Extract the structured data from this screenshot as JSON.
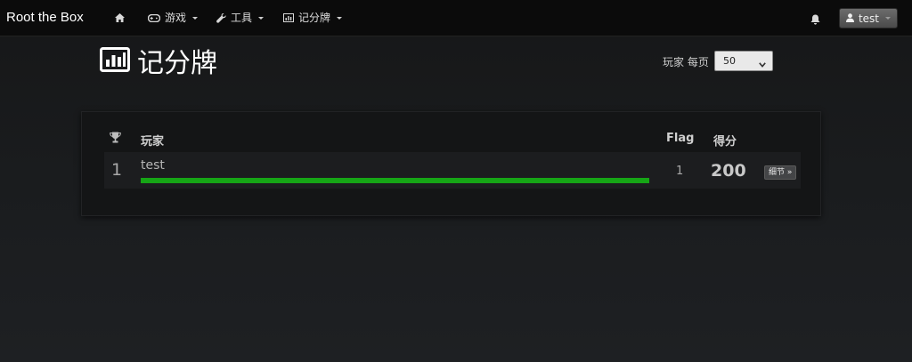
{
  "navbar": {
    "brand": "Root the Box",
    "items": [
      {
        "icon": "home-icon",
        "label": ""
      },
      {
        "icon": "gamepad-icon",
        "label": "游戏"
      },
      {
        "icon": "wrench-icon",
        "label": "工具"
      },
      {
        "icon": "bar-chart-icon",
        "label": "记分牌"
      }
    ],
    "notifications_icon": "bell-icon",
    "user": {
      "icon": "user-icon",
      "name": "test"
    }
  },
  "page": {
    "title": "记分牌",
    "title_icon": "bar-chart-icon",
    "per_page_label": "玩家 每页",
    "per_page_value": "50"
  },
  "scoreboard": {
    "headers": {
      "rank_icon": "trophy-icon",
      "player": "玩家",
      "flags": "Flag",
      "score": "得分"
    },
    "rows": [
      {
        "rank": "1",
        "name": "test",
        "progress": 1.0,
        "flags": "1",
        "score": "200",
        "details_label": "细节 »"
      }
    ]
  },
  "colors": {
    "navbar_bg": "#0b0b0b",
    "progress_fill": "#16a516",
    "panel_bg": "#141516"
  }
}
